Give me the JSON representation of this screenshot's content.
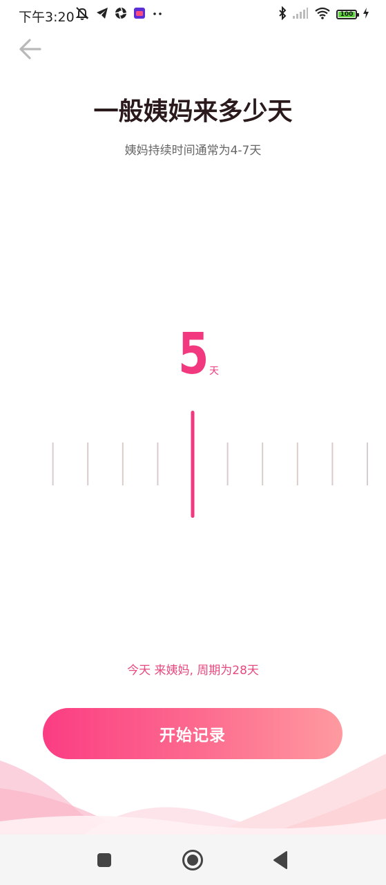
{
  "status_bar": {
    "time": "下午3:20",
    "battery_level": "100",
    "icons": [
      "mute-bell-icon",
      "telegram-icon",
      "aperture-icon",
      "app-icon",
      "more-icon",
      "bluetooth-icon",
      "signal-icon",
      "wifi-icon",
      "battery-icon",
      "charging-icon"
    ]
  },
  "page": {
    "back_icon": "arrow-left-icon",
    "title": "一般姨妈来多少天",
    "subtitle": "姨妈持续时间通常为4-7天"
  },
  "picker": {
    "value": "5",
    "unit": "天",
    "accent_color": "#f2397f",
    "tick_color": "#d9cccc"
  },
  "summary": {
    "text": "今天 来姨妈, 周期为28天"
  },
  "actions": {
    "start_label": "开始记录"
  },
  "nav_bar": {
    "icons": [
      "recents-square-icon",
      "home-circle-icon",
      "back-triangle-icon"
    ]
  }
}
